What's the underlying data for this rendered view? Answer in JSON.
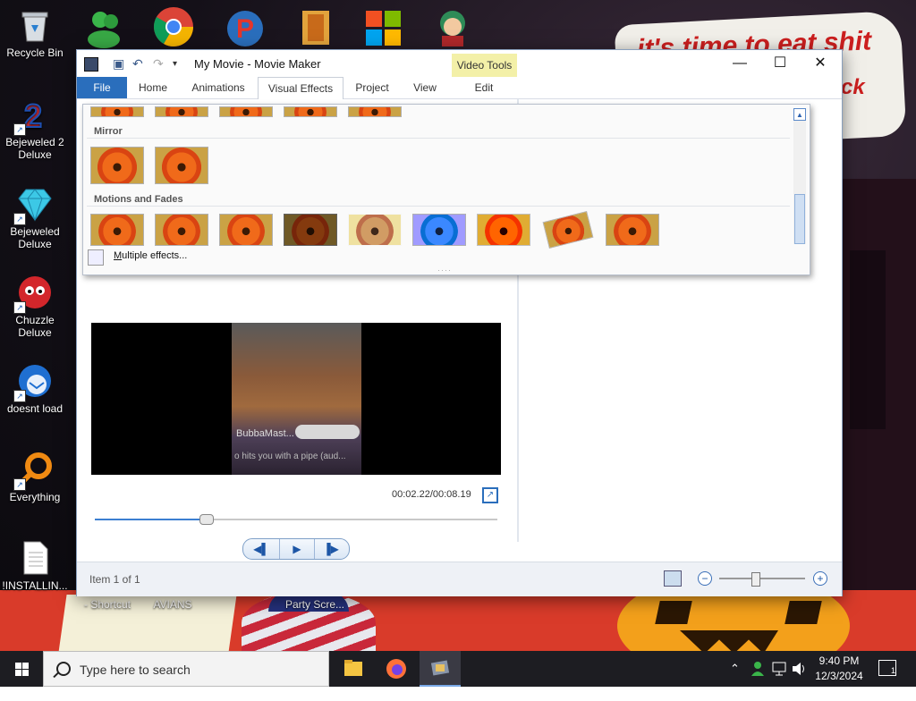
{
  "desktop": {
    "icons": [
      {
        "label": "Recycle Bin"
      },
      {
        "label": "Bejeweled 2 Deluxe"
      },
      {
        "label": "Bejeweled Deluxe"
      },
      {
        "label": "Chuzzle Deluxe"
      },
      {
        "label": "doesnt load"
      },
      {
        "label": "Everything"
      },
      {
        "label": "!INSTALLIN..."
      }
    ],
    "bottom_labels": [
      "- Shortcut",
      "AVIANS",
      "Party Scre..."
    ],
    "wallpaper_text_1": "it's time to eat shit",
    "wallpaper_text_2": "ck"
  },
  "window": {
    "title": "My Movie - Movie Maker",
    "contextual_group": "Video Tools",
    "controls": {
      "minimize": "—",
      "maximize": "☐",
      "close": "✕"
    },
    "tabs": [
      {
        "label": "File"
      },
      {
        "label": "Home"
      },
      {
        "label": "Animations"
      },
      {
        "label": "Visual Effects"
      },
      {
        "label": "Project"
      },
      {
        "label": "View"
      },
      {
        "label": "Edit"
      }
    ],
    "help": "?"
  },
  "gallery": {
    "sections": [
      {
        "title": "Mirror"
      },
      {
        "title": "Motions and Fades"
      }
    ],
    "footer_label_prefix": "M",
    "footer_label_rest": "ultiple effects..."
  },
  "preview": {
    "caption_name": "BubbaMast...",
    "caption_line": "o hits you with a pipe (aud...",
    "timecode": "00:02.22/00:08.19",
    "seek_progress": 0.275
  },
  "playback": {
    "prev": "◀▌",
    "play": "▶",
    "next": "▐▶"
  },
  "status": {
    "text": "Item 1 of 1",
    "zoom_level": 0.42
  },
  "taskbar": {
    "search_placeholder": "Type here to search",
    "clock_time": "9:40 PM",
    "clock_date": "12/3/2024",
    "notification_count": "1"
  },
  "colors": {
    "file_tab": "#2a6ebc",
    "video_tools": "#f3f0a8",
    "accent": "#3c7fd1"
  }
}
